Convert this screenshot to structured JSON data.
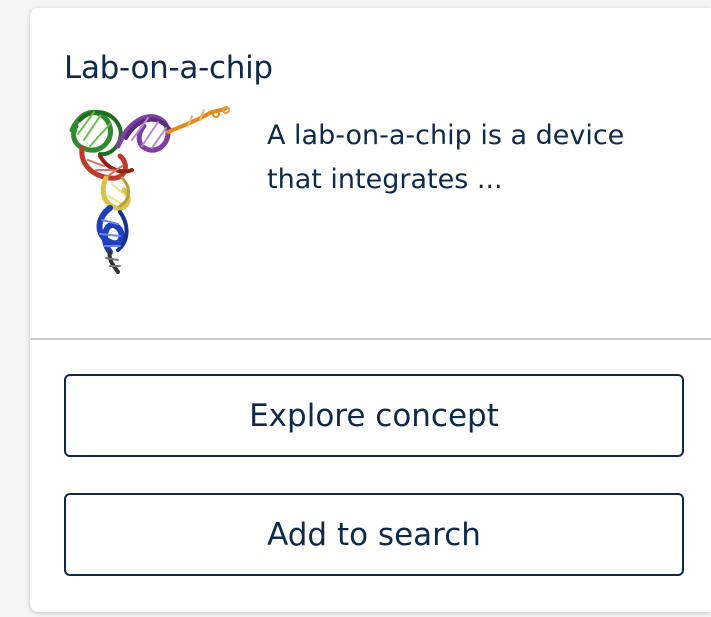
{
  "card": {
    "title": "Lab-on-a-chip",
    "description": "A lab-on-a-chip is a device that integrates ...",
    "thumbnail_icon": "trna-molecule-structure"
  },
  "actions": {
    "explore_label": "Explore concept",
    "add_label": "Add to search"
  },
  "colors": {
    "text": "#0e2a4b",
    "button_border": "#0e2a4b",
    "divider": "#c9ccd0",
    "card_background": "#ffffff",
    "page_background": "#f5f5f5"
  }
}
